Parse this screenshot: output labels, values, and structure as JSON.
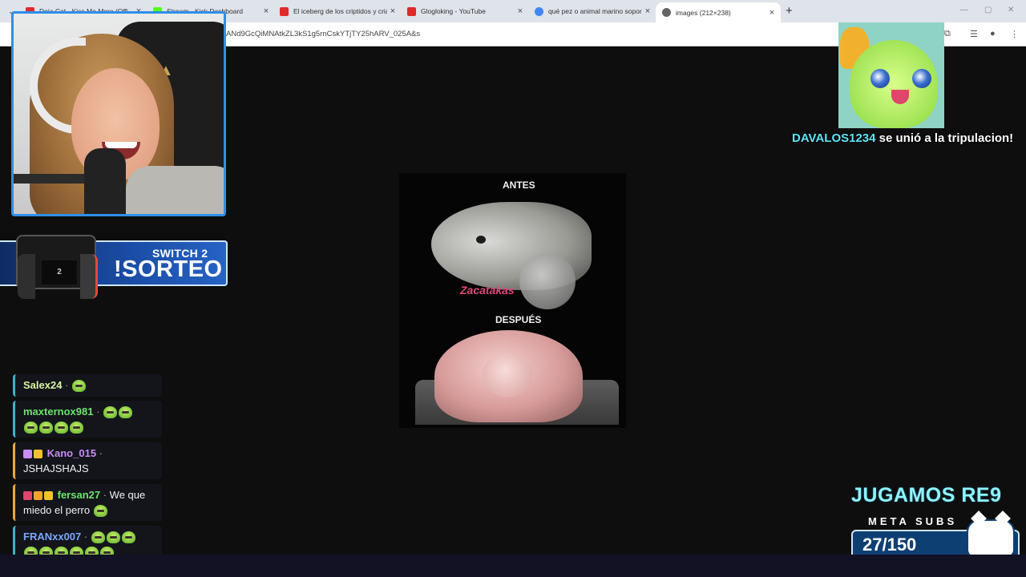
{
  "browser": {
    "tabs": [
      {
        "label": "Doja Cat - Kiss Me More (Offi",
        "favicon_color": "#e02a2a"
      },
      {
        "label": "Stream - Kick Dashboard",
        "favicon_color": "#53fc18"
      },
      {
        "label": "El iceberg de los criptidos y cria",
        "favicon_color": "#e02a2a"
      },
      {
        "label": "Glogloking - YouTube",
        "favicon_color": "#e02a2a"
      },
      {
        "label": "qué pez o animal marino sopor",
        "favicon_color": "#4285f4"
      },
      {
        "label": "images (212×238)",
        "favicon_color": "#666666"
      }
    ],
    "new_tab": "+",
    "url": "ANd9GcQiMNAtkZL3kS1g5rnCskYTjTY25hARV_025A&s"
  },
  "overlay": {
    "sorteo_sub": "SWITCH 2",
    "sorteo_main": "!SORTEO",
    "alert_user": "DAVALOS1234",
    "alert_msg": " se unió a la tripulacion!",
    "goal_title": "JUGAMOS RE9",
    "goal_sub": "META SUBS",
    "goal_count": "27/150",
    "console_label": "2"
  },
  "image": {
    "label_before": "ANTES",
    "label_after": "DESPUÉS",
    "watermark": "Zacatakas"
  },
  "chat": [
    {
      "user": "Salex24",
      "user_color": "#d8f5a2",
      "text": "",
      "emotes": 1
    },
    {
      "user": "maxternox981",
      "user_color": "#6de36d",
      "text": "",
      "emotes": 6
    },
    {
      "user": "Kano_015",
      "user_color": "#c98cf2",
      "text": "JSHAJSHAJS",
      "emotes": 0
    },
    {
      "user": "fersan27",
      "user_color": "#6de36d",
      "text": "We que miedo el perro",
      "emotes": 1
    },
    {
      "user": "FRANxx007",
      "user_color": "#7aa7ff",
      "text": "",
      "emotes": 9
    }
  ]
}
